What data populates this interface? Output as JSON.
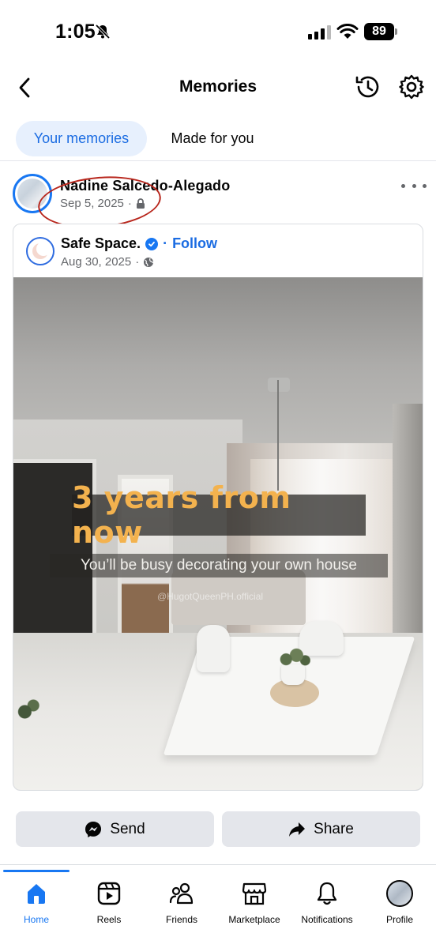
{
  "status_bar": {
    "time": "1:05",
    "battery": "89"
  },
  "header": {
    "title": "Memories"
  },
  "tabs": [
    {
      "label": "Your memories",
      "active": true
    },
    {
      "label": "Made for you",
      "active": false
    }
  ],
  "memory_post": {
    "author": "Nadine Salcedo-Alegado",
    "date": "Sep 5, 2025",
    "separator": "·",
    "privacy_icon": "lock-icon"
  },
  "shared_post": {
    "page_name": "Safe Space.",
    "verified": true,
    "follow_label": "Follow",
    "separator": "·",
    "date": "Aug 30, 2025",
    "audience_icon": "globe-icon",
    "image_text": {
      "headline": "3 years from now",
      "subtitle": "You’ll be busy decorating your own house",
      "watermark": "@HugotQueenPH.official"
    }
  },
  "actions": {
    "send_label": "Send",
    "share_label": "Share"
  },
  "bottom_nav": [
    {
      "label": "Home",
      "icon": "home-icon",
      "active": true
    },
    {
      "label": "Reels",
      "icon": "reels-icon",
      "active": false
    },
    {
      "label": "Friends",
      "icon": "friends-icon",
      "active": false
    },
    {
      "label": "Marketplace",
      "icon": "marketplace-icon",
      "active": false
    },
    {
      "label": "Notifications",
      "icon": "bell-icon",
      "active": false
    },
    {
      "label": "Profile",
      "icon": "profile-avatar",
      "active": false
    }
  ],
  "colors": {
    "accent": "#1877f2",
    "tab_active_bg": "#e7f0fd",
    "headline_text": "#f3b24e",
    "annotation": "#b8261c"
  }
}
